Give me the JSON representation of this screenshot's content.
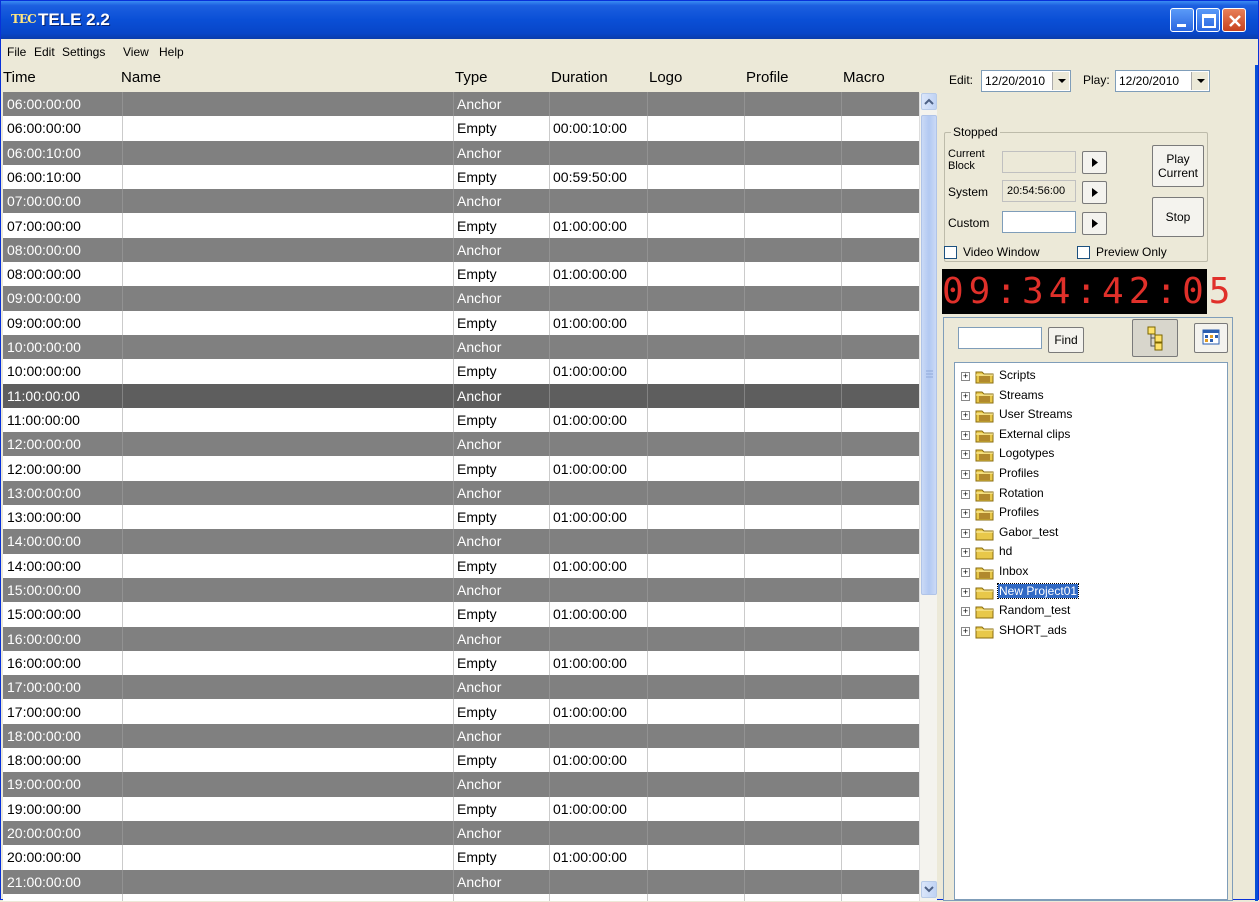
{
  "window": {
    "logo": "TEC",
    "title": "TELE 2.2"
  },
  "menu": [
    "File",
    "Edit",
    "Settings",
    "View",
    "Help"
  ],
  "columns": [
    "Time",
    "Name",
    "Type",
    "Duration",
    "Logo",
    "Profile",
    "Macro"
  ],
  "rows": [
    {
      "time": "06:00:00:00",
      "type": "Anchor",
      "duration": ""
    },
    {
      "time": "06:00:00:00",
      "type": "Empty",
      "duration": "00:00:10:00"
    },
    {
      "time": "06:00:10:00",
      "type": "Anchor",
      "duration": ""
    },
    {
      "time": "06:00:10:00",
      "type": "Empty",
      "duration": "00:59:50:00"
    },
    {
      "time": "07:00:00:00",
      "type": "Anchor",
      "duration": ""
    },
    {
      "time": "07:00:00:00",
      "type": "Empty",
      "duration": "01:00:00:00"
    },
    {
      "time": "08:00:00:00",
      "type": "Anchor",
      "duration": ""
    },
    {
      "time": "08:00:00:00",
      "type": "Empty",
      "duration": "01:00:00:00"
    },
    {
      "time": "09:00:00:00",
      "type": "Anchor",
      "duration": ""
    },
    {
      "time": "09:00:00:00",
      "type": "Empty",
      "duration": "01:00:00:00"
    },
    {
      "time": "10:00:00:00",
      "type": "Anchor",
      "duration": ""
    },
    {
      "time": "10:00:00:00",
      "type": "Empty",
      "duration": "01:00:00:00"
    },
    {
      "time": "11:00:00:00",
      "type": "Anchor",
      "duration": "",
      "selected": true
    },
    {
      "time": "11:00:00:00",
      "type": "Empty",
      "duration": "01:00:00:00"
    },
    {
      "time": "12:00:00:00",
      "type": "Anchor",
      "duration": ""
    },
    {
      "time": "12:00:00:00",
      "type": "Empty",
      "duration": "01:00:00:00"
    },
    {
      "time": "13:00:00:00",
      "type": "Anchor",
      "duration": ""
    },
    {
      "time": "13:00:00:00",
      "type": "Empty",
      "duration": "01:00:00:00"
    },
    {
      "time": "14:00:00:00",
      "type": "Anchor",
      "duration": ""
    },
    {
      "time": "14:00:00:00",
      "type": "Empty",
      "duration": "01:00:00:00"
    },
    {
      "time": "15:00:00:00",
      "type": "Anchor",
      "duration": ""
    },
    {
      "time": "15:00:00:00",
      "type": "Empty",
      "duration": "01:00:00:00"
    },
    {
      "time": "16:00:00:00",
      "type": "Anchor",
      "duration": ""
    },
    {
      "time": "16:00:00:00",
      "type": "Empty",
      "duration": "01:00:00:00"
    },
    {
      "time": "17:00:00:00",
      "type": "Anchor",
      "duration": ""
    },
    {
      "time": "17:00:00:00",
      "type": "Empty",
      "duration": "01:00:00:00"
    },
    {
      "time": "18:00:00:00",
      "type": "Anchor",
      "duration": ""
    },
    {
      "time": "18:00:00:00",
      "type": "Empty",
      "duration": "01:00:00:00"
    },
    {
      "time": "19:00:00:00",
      "type": "Anchor",
      "duration": ""
    },
    {
      "time": "19:00:00:00",
      "type": "Empty",
      "duration": "01:00:00:00"
    },
    {
      "time": "20:00:00:00",
      "type": "Anchor",
      "duration": ""
    },
    {
      "time": "20:00:00:00",
      "type": "Empty",
      "duration": "01:00:00:00"
    },
    {
      "time": "21:00:00:00",
      "type": "Anchor",
      "duration": ""
    }
  ],
  "panel": {
    "edit_label": "Edit:",
    "edit_date": "12/20/2010",
    "play_label": "Play:",
    "play_date": "12/20/2010",
    "status": "Stopped",
    "current_block_label": "Current\nBlock",
    "system_label": "System",
    "system_time": "20:54:56:00",
    "custom_label": "Custom",
    "play_current": "Play\nCurrent",
    "stop": "Stop",
    "video_window": "Video Window",
    "preview_only": "Preview Only",
    "clock": "09:34:42:05",
    "find": "Find"
  },
  "tree": [
    {
      "label": "Scripts",
      "icon": "folder-special-icon"
    },
    {
      "label": "Streams",
      "icon": "folder-special-icon"
    },
    {
      "label": "User Streams",
      "icon": "folder-special-icon"
    },
    {
      "label": "External clips",
      "icon": "folder-special-icon"
    },
    {
      "label": "Logotypes",
      "icon": "folder-special-icon"
    },
    {
      "label": "Profiles",
      "icon": "folder-special-icon"
    },
    {
      "label": "Rotation",
      "icon": "folder-special-icon"
    },
    {
      "label": "Profiles",
      "icon": "folder-special-icon"
    },
    {
      "label": "Gabor_test",
      "icon": "folder-icon"
    },
    {
      "label": "hd",
      "icon": "folder-icon"
    },
    {
      "label": "Inbox",
      "icon": "folder-special-icon"
    },
    {
      "label": "New Project01",
      "icon": "folder-icon",
      "selected": true
    },
    {
      "label": "Random_test",
      "icon": "folder-icon"
    },
    {
      "label": "SHORT_ads",
      "icon": "folder-icon"
    }
  ]
}
